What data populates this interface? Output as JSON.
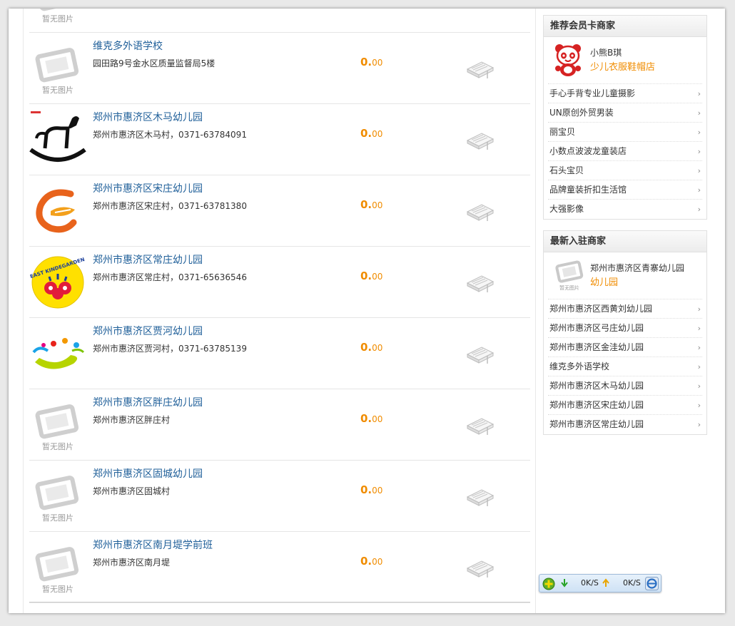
{
  "placeholder_text": "暂无图片",
  "price": {
    "whole": "0.",
    "fraction": "00"
  },
  "listings": [
    {
      "name": "",
      "address": "",
      "logo": "no-image"
    },
    {
      "name": "维克多外语学校",
      "address": "园田路9号金水区质量监督局5楼",
      "logo": "no-image"
    },
    {
      "name": "郑州市惠济区木马幼儿园",
      "address": "郑州市惠济区木马村，0371-63784091",
      "logo": "rocking-horse"
    },
    {
      "name": "郑州市惠济区宋庄幼儿园",
      "address": "郑州市惠济区宋庄村，0371-63781380",
      "logo": "orange-e"
    },
    {
      "name": "郑州市惠济区常庄幼儿园",
      "address": "郑州市惠济区常庄村，0371-65636546",
      "logo": "east-kindergarten"
    },
    {
      "name": "郑州市惠济区贾河幼儿园",
      "address": "郑州市惠济区贾河村，0371-63785139",
      "logo": "colorful-swoosh"
    },
    {
      "name": "郑州市惠济区胖庄幼儿园",
      "address": "郑州市惠济区胖庄村",
      "logo": "no-image"
    },
    {
      "name": "郑州市惠济区固城幼儿园",
      "address": "郑州市惠济区固城村",
      "logo": "no-image"
    },
    {
      "name": "郑州市惠济区南月堤学前班",
      "address": "郑州市惠济区南月堤",
      "logo": "no-image"
    }
  ],
  "sidebar": {
    "recommended": {
      "title": "推荐会员卡商家",
      "featured": {
        "name": "小熊B琪",
        "category": "少儿衣服鞋帽店",
        "icon": "panda-icon"
      },
      "links": [
        "手心手背专业儿童摄影",
        "UN原创外贸男装",
        "丽宝贝",
        "小数点波波龙童装店",
        "石头宝贝",
        "品牌童装折扣生活馆",
        "大强影像"
      ]
    },
    "newest": {
      "title": "最新入驻商家",
      "featured": {
        "name": "郑州市惠济区青寨幼儿园",
        "category": "幼儿园",
        "icon": "no-image"
      },
      "links": [
        "郑州市惠济区西黄刘幼儿园",
        "郑州市惠济区弓庄幼儿园",
        "郑州市惠济区金洼幼儿园",
        "维克多外语学校",
        "郑州市惠济区木马幼儿园",
        "郑州市惠济区宋庄幼儿园",
        "郑州市惠济区常庄幼儿园"
      ]
    },
    "arrow": "›"
  },
  "tray": {
    "down_speed": "0K/S",
    "up_speed": "0K/S"
  },
  "colors": {
    "link": "#1f5f99",
    "accent": "#f08c00"
  }
}
